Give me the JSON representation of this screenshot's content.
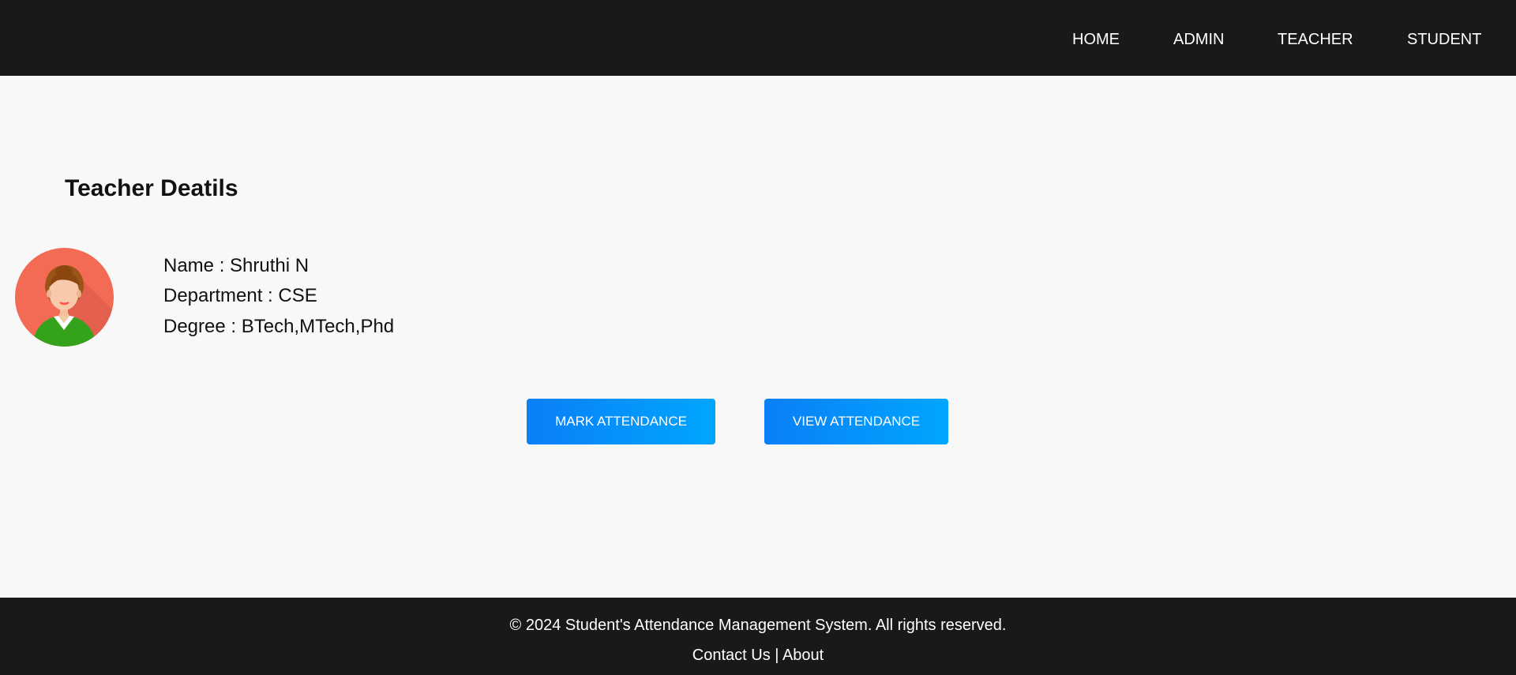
{
  "nav": {
    "items": [
      {
        "label": "HOME"
      },
      {
        "label": "ADMIN"
      },
      {
        "label": "TEACHER"
      },
      {
        "label": "STUDENT"
      }
    ]
  },
  "main": {
    "title": "Teacher Deatils",
    "avatar_icon": "teacher-avatar-icon",
    "details": {
      "name": "Name : Shruthi N",
      "department": "Department : CSE",
      "degree": "Degree : BTech,MTech,Phd"
    },
    "buttons": {
      "mark": "MARK ATTENDANCE",
      "view": "VIEW ATTENDANCE"
    }
  },
  "footer": {
    "copyright": "© 2024 Student's Attendance Management System. All rights reserved.",
    "contact": "Contact Us",
    "separator": "|",
    "about": "About"
  },
  "colors": {
    "nav_background": "#191919",
    "page_background": "#f8f8f8",
    "button_start": "#0a7ff6",
    "button_end": "#00a6ff",
    "avatar_background": "#f36a55",
    "avatar_clothing": "#35a21b"
  }
}
